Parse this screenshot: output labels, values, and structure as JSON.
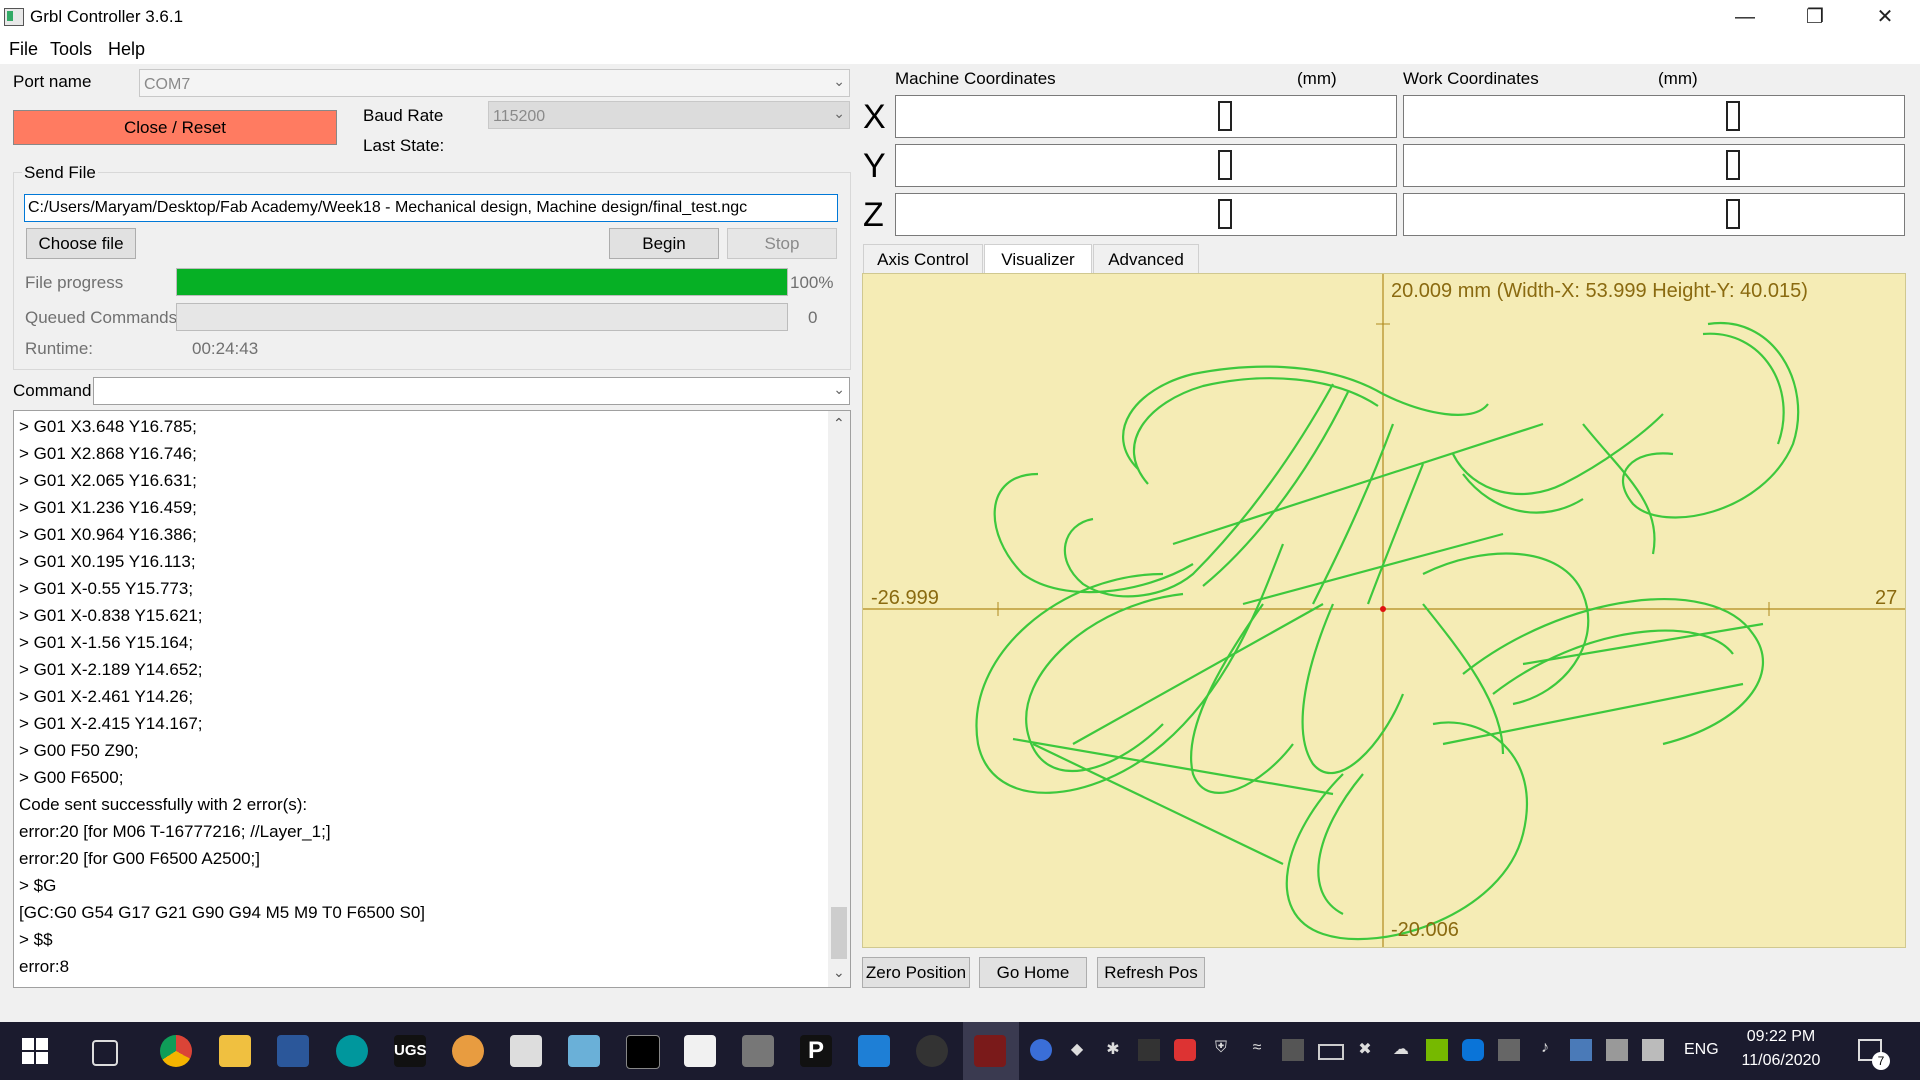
{
  "window": {
    "title": "Grbl Controller 3.6.1"
  },
  "menu": {
    "file": "File",
    "tools": "Tools",
    "help": "Help"
  },
  "connection": {
    "port_label": "Port name",
    "port_value": "COM7",
    "close_button": "Close / Reset",
    "baud_label": "Baud Rate",
    "baud_value": "115200",
    "last_state_label": "Last State:"
  },
  "send_file": {
    "group_label": "Send File",
    "path": "C:/Users/Maryam/Desktop/Fab Academy/Week18 -  Mechanical design, Machine design/final_test.ngc",
    "choose_button": "Choose file",
    "begin_button": "Begin",
    "stop_button": "Stop",
    "progress_label": "File progress",
    "progress_percent": "100%",
    "progress_value": 1.0,
    "queued_label": "Queued Commands",
    "queued_value": "0",
    "runtime_label": "Runtime:",
    "runtime_value": "00:24:43"
  },
  "command": {
    "label": "Command",
    "value": ""
  },
  "console_lines": [
    "> G01 X3.648 Y16.785;",
    "> G01 X2.868 Y16.746;",
    "> G01 X2.065 Y16.631;",
    "> G01 X1.236 Y16.459;",
    "> G01 X0.964 Y16.386;",
    "> G01 X0.195 Y16.113;",
    "> G01 X-0.55 Y15.773;",
    "> G01 X-0.838 Y15.621;",
    "> G01 X-1.56 Y15.164;",
    "> G01 X-2.189 Y14.652;",
    "> G01 X-2.461 Y14.26;",
    "> G01 X-2.415 Y14.167;",
    "> G00 F50 Z90;",
    "> G00 F6500;",
    "Code sent successfully with 2 error(s):",
    "error:20 [for M06 T-16777216; //Layer_1;]",
    "error:20 [for G00 F6500 A2500;]",
    "> $G",
    "[GC:G0 G54 G17 G21 G90 G94 M5 M9 T0 F6500 S0]",
    "> $$",
    "error:8"
  ],
  "coords": {
    "machine_label": "Machine Coordinates",
    "work_label": "Work Coordinates",
    "unit": "(mm)",
    "axes": [
      "X",
      "Y",
      "Z"
    ],
    "machine_values": [
      "0",
      "0",
      "0"
    ],
    "work_values": [
      "0",
      "0",
      "0"
    ]
  },
  "tabs": [
    "Axis Control",
    "Visualizer",
    "Advanced"
  ],
  "active_tab": "Visualizer",
  "visualizer": {
    "top_label": "20.009 mm  (Width-X: 53.999  Height-Y: 40.015)",
    "left_label": "-26.999",
    "right_label": "27",
    "bottom_label": "-20.006",
    "path_color": "#3dc83d"
  },
  "bottom_buttons": {
    "zero": "Zero Position",
    "home": "Go Home",
    "refresh": "Refresh Pos"
  },
  "taskbar": {
    "icons": [
      "windows-start-icon",
      "task-view-icon",
      "chrome-icon",
      "file-explorer-icon",
      "word-icon",
      "arduino-icon",
      "ugs-icon",
      "paint-icon",
      "inkscape-icon",
      "notepad-icon",
      "terminal-icon",
      "java-icon",
      "image-viewer-icon",
      "p-app-icon",
      "photos-icon",
      "inkscape-alt-icon",
      "grbl-controller-icon"
    ],
    "ugs_text": "UGS",
    "p_text": "P",
    "language": "ENG",
    "time": "09:22 PM",
    "date": "11/06/2020",
    "notification_count": "7"
  }
}
